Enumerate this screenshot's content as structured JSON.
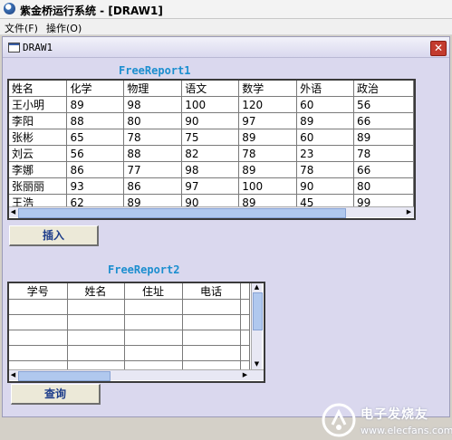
{
  "app": {
    "title": "紫金桥运行系统 - [DRAW1]"
  },
  "menu": {
    "items": [
      "文件(F)",
      "操作(O)"
    ]
  },
  "child_window": {
    "title": "DRAW1",
    "close_glyph": "✕"
  },
  "report1": {
    "title": "FreeReport1",
    "headers": [
      "姓名",
      "化学",
      "物理",
      "语文",
      "数学",
      "外语",
      "政治"
    ],
    "rows": [
      [
        "王小明",
        "89",
        "98",
        "100",
        "120",
        "60",
        "56"
      ],
      [
        "李阳",
        "88",
        "80",
        "90",
        "97",
        "89",
        "66"
      ],
      [
        "张彬",
        "65",
        "78",
        "75",
        "89",
        "60",
        "89"
      ],
      [
        "刘云",
        "56",
        "88",
        "82",
        "78",
        "23",
        "78"
      ],
      [
        "李娜",
        "86",
        "77",
        "98",
        "89",
        "78",
        "66"
      ],
      [
        "张丽丽",
        "93",
        "86",
        "97",
        "100",
        "90",
        "80"
      ],
      [
        "王浩",
        "62",
        "89",
        "90",
        "89",
        "45",
        "99"
      ]
    ]
  },
  "insert_button": {
    "label": "插入"
  },
  "report2": {
    "title": "FreeReport2",
    "headers": [
      "学号",
      "姓名",
      "住址",
      "电话"
    ],
    "empty_rows": 5
  },
  "query_button": {
    "label": "查询"
  },
  "watermark": {
    "text": "电子发烧友",
    "url": "www.elecfans.com"
  }
}
